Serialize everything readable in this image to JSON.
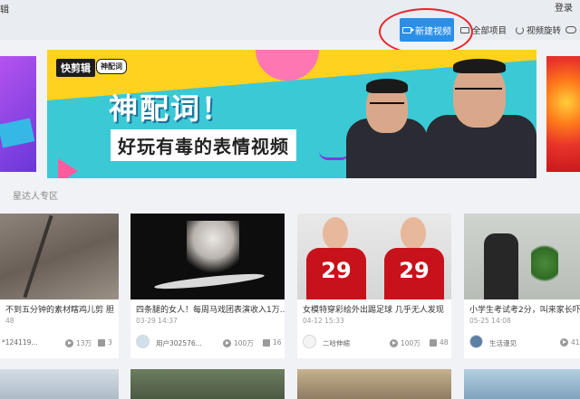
{
  "header": {
    "logo_fragment": "辑",
    "login": "登录",
    "new_video": "新建视频",
    "all_projects": "全部项目",
    "video_rotate": "视频旋转"
  },
  "banner": {
    "brand": "快剪辑",
    "brand_tag": "神配词",
    "headline_line1": "神配词！",
    "headline_line2": "好玩有毒的表情视频"
  },
  "section": {
    "title": "星达人专区"
  },
  "cards": [
    {
      "title": "不到五分钟的素材瞎鸡儿剪 胆",
      "date": "48",
      "author": "*124119...",
      "plays": "13万",
      "likes": "3"
    },
    {
      "title": "四条腿的女人！每周马戏团表演收入1万...",
      "date": "03-29 14:37",
      "author": "用户302576...",
      "plays": "100万",
      "likes": "16"
    },
    {
      "title": "女模特穿彩绘外出踢足球 几乎无人发现",
      "date": "04-12 15:33",
      "author": "二哈伸缩",
      "plays": "100万",
      "likes": "48",
      "jersey_numbers": [
        "29",
        "29"
      ]
    },
    {
      "title": "小学生考试考2分，叫来家长吓坏",
      "date": "05-25 14:08",
      "author": "生活漫见",
      "plays": "41",
      "likes": ""
    }
  ],
  "colors": {
    "accent_blue": "#2b8fe8",
    "annotation_red": "#e8262b",
    "banner_cyan": "#3bc9d6",
    "banner_yellow": "#ffd21f"
  }
}
